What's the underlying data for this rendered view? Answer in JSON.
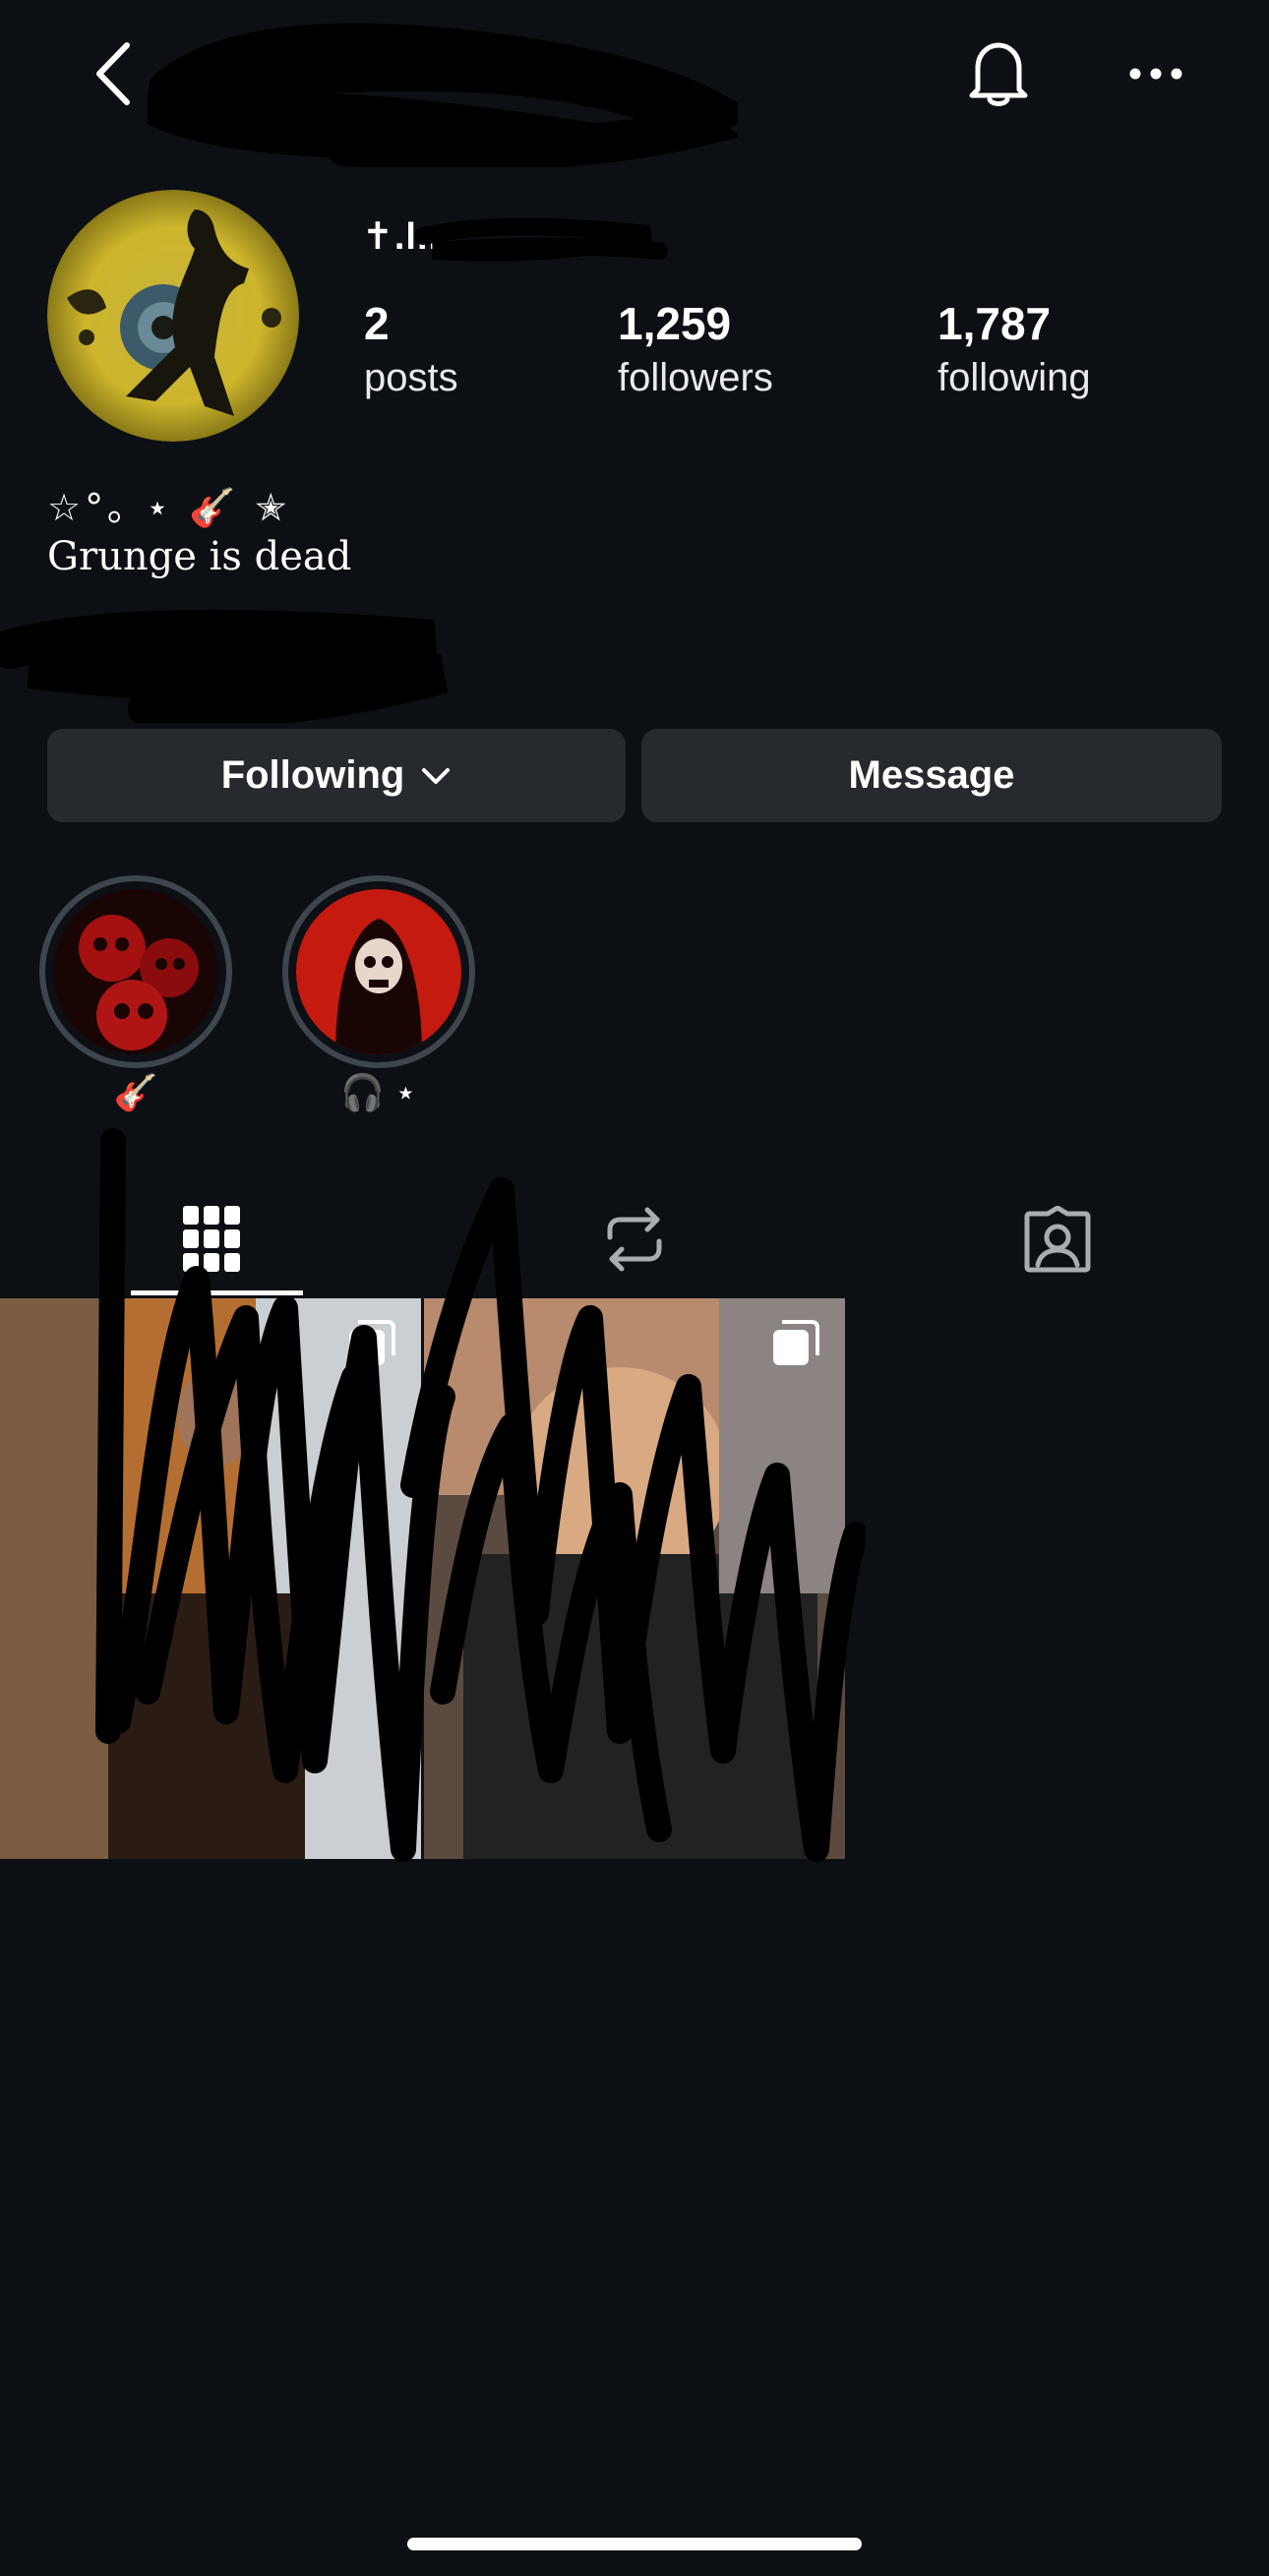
{
  "header": {
    "back_icon": "chevron-left-icon",
    "notifications_icon": "bell-icon",
    "more_icon": "more-horizontal-icon"
  },
  "profile": {
    "display_name": "✝.l..",
    "stats": {
      "posts": {
        "count": "2",
        "label": "posts"
      },
      "followers": {
        "count": "1,259",
        "label": "followers"
      },
      "following": {
        "count": "1,787",
        "label": "following"
      }
    },
    "bio": {
      "decoration": "☆°｡ ⋆ 🎸 ✭",
      "text": "Grunge is dead"
    }
  },
  "actions": {
    "following_label": "Following",
    "message_label": "Message"
  },
  "highlights": [
    {
      "label": "🎸"
    },
    {
      "label": "🎧 ⋆"
    }
  ],
  "tabs": [
    {
      "name": "grid",
      "icon": "grid-icon",
      "active": true
    },
    {
      "name": "reposts",
      "icon": "repost-icon",
      "active": false
    },
    {
      "name": "tagged",
      "icon": "tagged-person-icon",
      "active": false
    }
  ],
  "colors": {
    "background": "#0c1014",
    "button": "#262a2f",
    "text": "#ffffff",
    "highlight_ring": "#3e454d"
  }
}
